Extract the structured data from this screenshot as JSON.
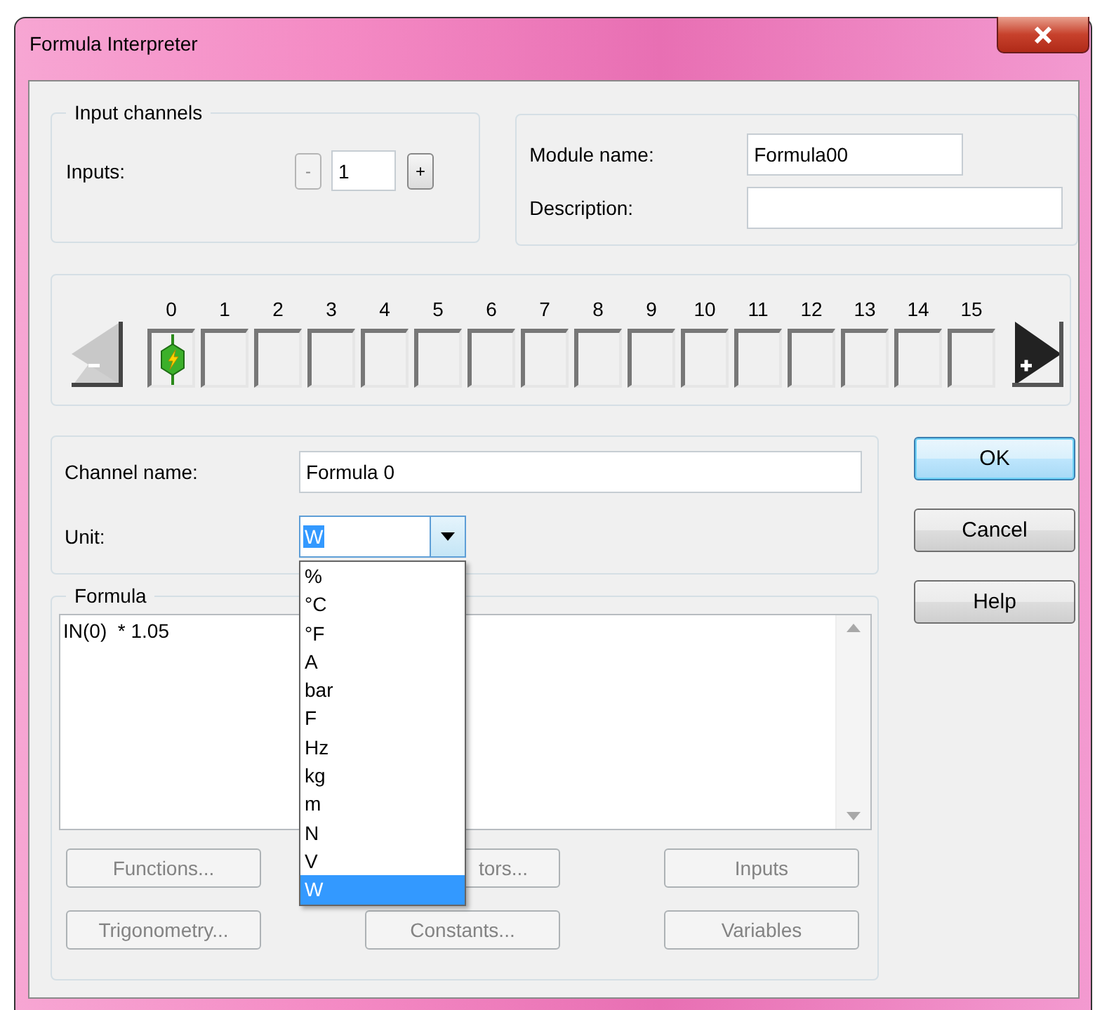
{
  "window": {
    "title": "Formula Interpreter"
  },
  "input_channels": {
    "title": "Input channels",
    "label": "Inputs:",
    "value": "1",
    "decrement": {
      "label": "-",
      "disabled": true
    },
    "increment": {
      "label": "+",
      "disabled": false
    }
  },
  "module": {
    "name_label": "Module name:",
    "name_value": "Formula00",
    "description_label": "Description:"
  },
  "channel_strip": {
    "previous_disabled": true,
    "next_disabled": false,
    "slots": [
      {
        "number": "0",
        "connected": true
      },
      {
        "number": "1",
        "connected": false
      },
      {
        "number": "2",
        "connected": false
      },
      {
        "number": "3",
        "connected": false
      },
      {
        "number": "4",
        "connected": false
      },
      {
        "number": "5",
        "connected": false
      },
      {
        "number": "6",
        "connected": false
      },
      {
        "number": "7",
        "connected": false
      },
      {
        "number": "8",
        "connected": false
      },
      {
        "number": "9",
        "connected": false
      },
      {
        "number": "10",
        "connected": false
      },
      {
        "number": "11",
        "connected": false
      },
      {
        "number": "12",
        "connected": false
      },
      {
        "number": "13",
        "connected": false
      },
      {
        "number": "14",
        "connected": false
      },
      {
        "number": "15",
        "connected": false
      }
    ]
  },
  "channel": {
    "name_label": "Channel name:",
    "name_value": "Formula 0",
    "unit_label": "Unit:",
    "unit_value": "W",
    "expanded": true,
    "unit_options": [
      {
        "label": "%",
        "selected": false
      },
      {
        "label": "°C",
        "selected": false
      },
      {
        "label": "°F",
        "selected": false
      },
      {
        "label": "A",
        "selected": false
      },
      {
        "label": "bar",
        "selected": false
      },
      {
        "label": "F",
        "selected": false
      },
      {
        "label": "Hz",
        "selected": false
      },
      {
        "label": "kg",
        "selected": false
      },
      {
        "label": "m",
        "selected": false
      },
      {
        "label": "N",
        "selected": false
      },
      {
        "label": "V",
        "selected": false
      },
      {
        "label": "W",
        "selected": true
      }
    ]
  },
  "formula": {
    "title": "Formula",
    "text": "IN(0)  * 1.05",
    "buttons": [
      {
        "label": "Functions...",
        "disabled": true
      },
      {
        "label": "tors...",
        "disabled": true
      },
      {
        "label": "Inputs",
        "disabled": true
      },
      {
        "label": "Trigonometry...",
        "disabled": true
      },
      {
        "label": "Constants...",
        "disabled": true
      },
      {
        "label": "Variables",
        "disabled": true
      }
    ]
  },
  "buttons": [
    {
      "label": "OK",
      "default": true
    },
    {
      "label": "Cancel",
      "default": false
    },
    {
      "label": "Help",
      "default": false
    }
  ]
}
